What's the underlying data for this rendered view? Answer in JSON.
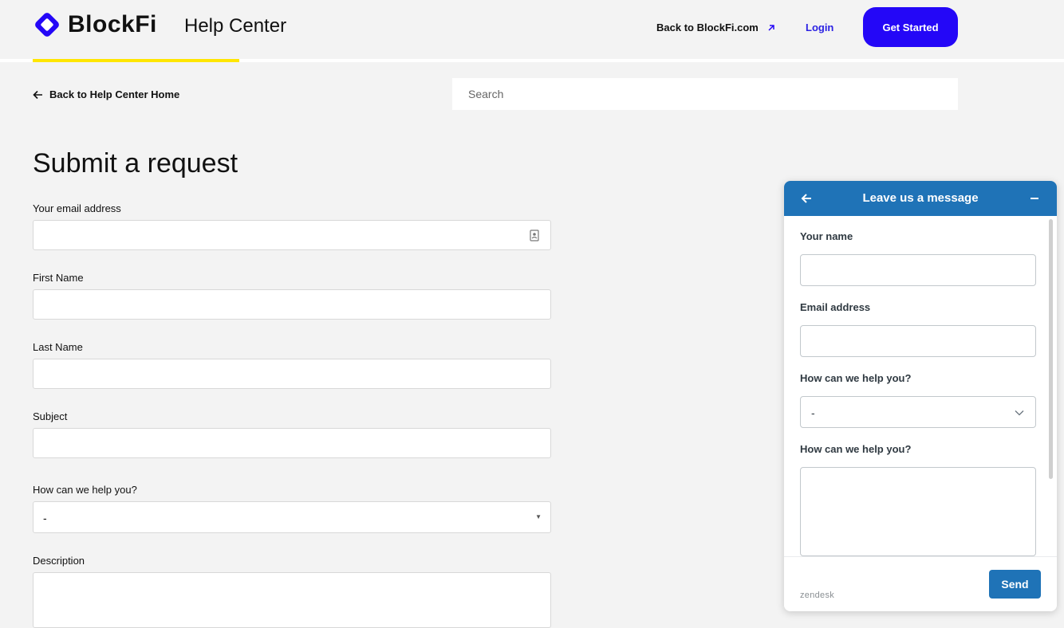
{
  "header": {
    "brand": "BlockFi",
    "section_title": "Help Center",
    "back_link": "Back to BlockFi.com",
    "login": "Login",
    "cta": "Get Started",
    "brand_color": "#2407f7",
    "accent_color": "#ffe600"
  },
  "subnav": {
    "back_home": "Back to Help Center Home",
    "search_placeholder": "Search"
  },
  "form": {
    "title": "Submit a request",
    "fields": [
      {
        "label": "Your email address",
        "value": ""
      },
      {
        "label": "First Name",
        "value": ""
      },
      {
        "label": "Last Name",
        "value": ""
      },
      {
        "label": "Subject",
        "value": ""
      }
    ],
    "help_label": "How can we help you?",
    "help_value": "-",
    "description_label": "Description"
  },
  "widget": {
    "title": "Leave us a message",
    "name_label": "Your name",
    "email_label": "Email address",
    "help_label": "How can we help you?",
    "help_value": "-",
    "message_label": "How can we help you?",
    "send": "Send",
    "footer_brand": "zendesk",
    "header_color": "#1f73b7"
  }
}
